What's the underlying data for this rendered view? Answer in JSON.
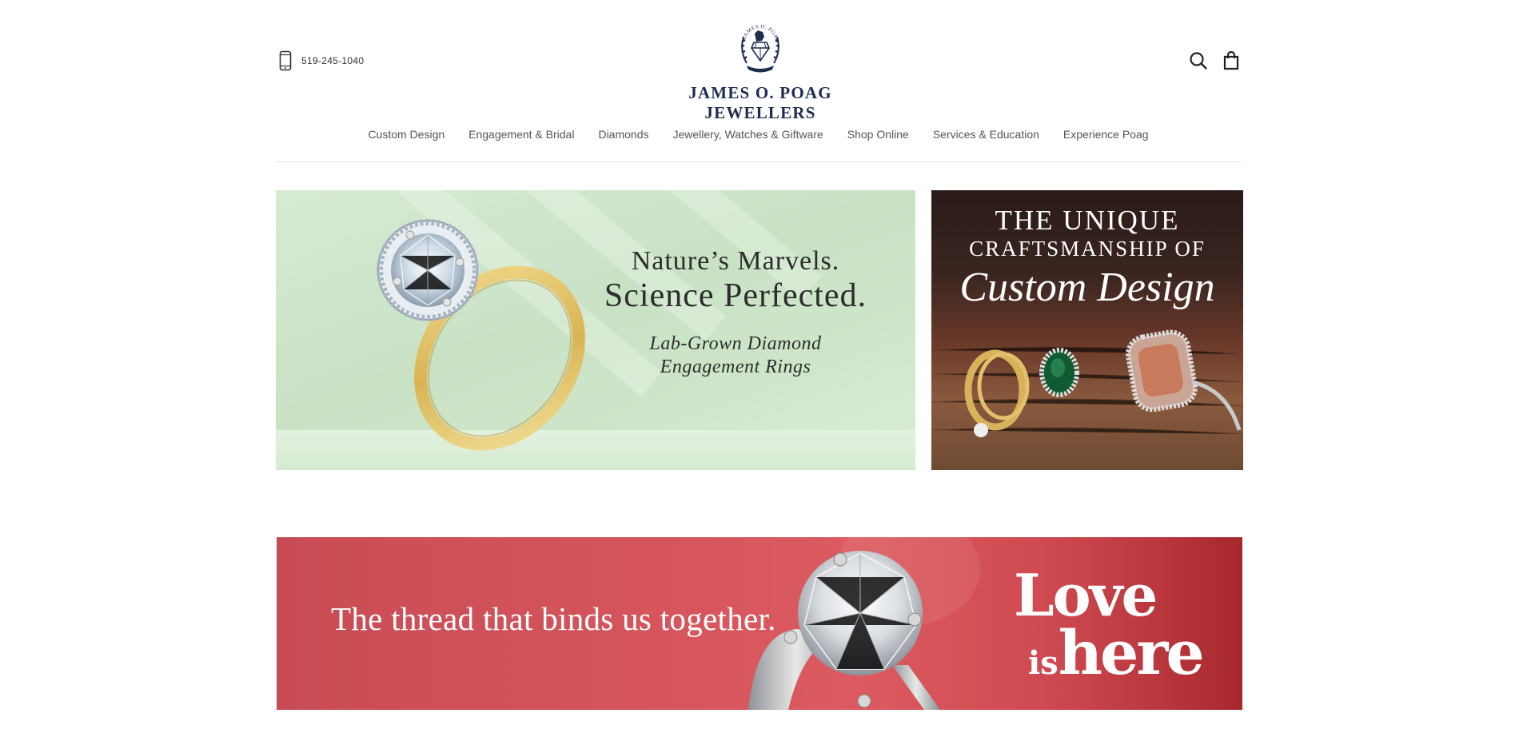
{
  "header": {
    "phone": "519-245-1040",
    "brand": "JAMES O. POAG JEWELLERS",
    "crest_text": "JAMES O. POAG",
    "icons": {
      "search": "search-icon",
      "cart": "shopping-bag-icon",
      "phone": "phone-icon"
    }
  },
  "nav": {
    "items": [
      {
        "label": "Custom Design"
      },
      {
        "label": "Engagement & Bridal"
      },
      {
        "label": "Diamonds"
      },
      {
        "label": "Jewellery, Watches & Giftware"
      },
      {
        "label": "Shop Online"
      },
      {
        "label": "Services & Education"
      },
      {
        "label": "Experience Poag"
      }
    ]
  },
  "banners": {
    "lab_grown": {
      "line1": "Nature’s Marvels.",
      "line2": "Science Perfected.",
      "sub1": "Lab-Grown Diamond",
      "sub2": "Engagement Rings"
    },
    "custom": {
      "line1": "THE UNIQUE",
      "line2": "CRAFTSMANSHIP OF",
      "line3": "Custom Design"
    },
    "love": {
      "tagline": "The thread that binds us together.",
      "love": "Love",
      "is": "is",
      "here": "here"
    }
  },
  "colors": {
    "brand_navy": "#1c2d4f",
    "green_banner": "#cfe5c9",
    "red_banner": "#d6555d"
  }
}
